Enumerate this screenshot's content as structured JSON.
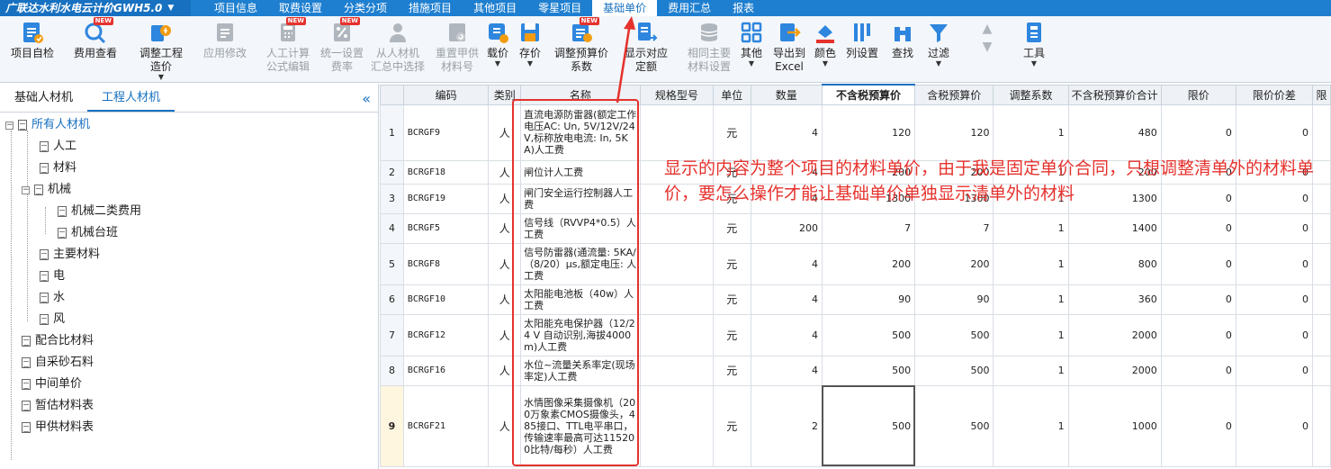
{
  "app": {
    "title": "广联达水利水电云计价GWH5.0"
  },
  "menu": [
    {
      "label": "项目信息"
    },
    {
      "label": "取费设置"
    },
    {
      "label": "分类分项"
    },
    {
      "label": "措施项目"
    },
    {
      "label": "其他项目"
    },
    {
      "label": "零星项目"
    },
    {
      "label": "基础单价",
      "active": true
    },
    {
      "label": "费用汇总"
    },
    {
      "label": "报表"
    }
  ],
  "toolbar": {
    "self_check": "项目自检",
    "fee_view": "费用查看",
    "adjust_price_1": "调整工程",
    "adjust_price_2": "造价",
    "apply_modify": "应用修改",
    "labor_calc_1": "人工计算",
    "labor_calc_2": "公式编辑",
    "unify_rate_1": "统一设置",
    "unify_rate_2": "费率",
    "select_1": "从人材机",
    "select_2": "汇总中选择",
    "reset_1": "重置甲供",
    "reset_2": "材料号",
    "load_price": "载价",
    "save_price": "存价",
    "adjust_budget_1": "调整预算价",
    "adjust_budget_2": "系数",
    "show_quota_1": "显示对应",
    "show_quota_2": "定额",
    "same_main_1": "相同主要",
    "same_main_2": "材料设置",
    "other": "其他",
    "export_1": "导出到",
    "export_2": "Excel",
    "color": "颜色",
    "col_setting": "列设置",
    "find": "查找",
    "filter": "过滤",
    "tools": "工具",
    "new_badge": "NEW"
  },
  "leftpanel": {
    "tabs": [
      {
        "label": "基础人材机"
      },
      {
        "label": "工程人材机",
        "active": true
      }
    ],
    "tree": [
      {
        "label": "所有人材机"
      },
      {
        "label": "人工"
      },
      {
        "label": "材料"
      },
      {
        "label": "机械"
      },
      {
        "label": "机械二类费用"
      },
      {
        "label": "机械台班"
      },
      {
        "label": "主要材料"
      },
      {
        "label": "电"
      },
      {
        "label": "水"
      },
      {
        "label": "风"
      },
      {
        "label": "配合比材料"
      },
      {
        "label": "自采砂石料"
      },
      {
        "label": "中间单价"
      },
      {
        "label": "暂估材料表"
      },
      {
        "label": "甲供材料表"
      }
    ]
  },
  "grid": {
    "headers": [
      "",
      "编码",
      "类别",
      "名称",
      "规格型号",
      "单位",
      "数量",
      "不含税预算价",
      "含税预算价",
      "调整系数",
      "不含税预算价合计",
      "限价",
      "限价价差",
      "限"
    ],
    "rows": [
      {
        "n": "1",
        "code": "BCRGF9",
        "cat": "人",
        "name": "直流电源防雷器(额定工作电压AC: Un, 5V/12V/24V,标称放电电流: In, 5KA)人工费",
        "unit": "元",
        "qty": "4",
        "price": "120",
        "taxprice": "120",
        "coef": "1",
        "total": "480",
        "limit": "0",
        "diff": "0"
      },
      {
        "n": "2",
        "code": "BCRGF18",
        "cat": "人",
        "name": "闸位计人工费",
        "unit": "元",
        "qty": "4",
        "price": "200",
        "taxprice": "200",
        "coef": "1",
        "total": "200",
        "limit": "0",
        "diff": "0"
      },
      {
        "n": "3",
        "code": "BCRGF19",
        "cat": "人",
        "name": "闸门安全运行控制器人工费",
        "unit": "元",
        "qty": "4",
        "price": "1300",
        "taxprice": "1300",
        "coef": "1",
        "total": "1300",
        "limit": "0",
        "diff": "0"
      },
      {
        "n": "4",
        "code": "BCRGF5",
        "cat": "人",
        "name": "信号线（RVVP4*0.5）人工费",
        "unit": "元",
        "qty": "200",
        "price": "7",
        "taxprice": "7",
        "coef": "1",
        "total": "1400",
        "limit": "0",
        "diff": "0"
      },
      {
        "n": "5",
        "code": "BCRGF8",
        "cat": "人",
        "name": "信号防雷器(通流量: 5KA/（8/20）μs,额定电压: 人工费",
        "unit": "元",
        "qty": "4",
        "price": "200",
        "taxprice": "200",
        "coef": "1",
        "total": "800",
        "limit": "0",
        "diff": "0"
      },
      {
        "n": "6",
        "code": "BCRGF10",
        "cat": "人",
        "name": "太阳能电池板（40w）人工费",
        "unit": "元",
        "qty": "4",
        "price": "90",
        "taxprice": "90",
        "coef": "1",
        "total": "360",
        "limit": "0",
        "diff": "0"
      },
      {
        "n": "7",
        "code": "BCRGF12",
        "cat": "人",
        "name": "太阳能充电保护器（12/24 V 自动识别,海拔4000 m)人工费",
        "unit": "元",
        "qty": "4",
        "price": "500",
        "taxprice": "500",
        "coef": "1",
        "total": "2000",
        "limit": "0",
        "diff": "0"
      },
      {
        "n": "8",
        "code": "BCRGF16",
        "cat": "人",
        "name": "水位~流量关系率定(现场率定)人工费",
        "unit": "元",
        "qty": "4",
        "price": "500",
        "taxprice": "500",
        "coef": "1",
        "total": "2000",
        "limit": "0",
        "diff": "0"
      },
      {
        "n": "9",
        "code": "BCRGF21",
        "cat": "人",
        "name": "水情图像采集摄像机（200万象素CMOS摄像头，485接口、TTL电平串口，传输速率最高可达115200比特/每秒）人工费",
        "unit": "元",
        "qty": "2",
        "price": "500",
        "taxprice": "500",
        "coef": "1",
        "total": "1000",
        "limit": "0",
        "diff": "0"
      }
    ]
  },
  "annotation": {
    "text": "显示的内容为整个项目的材料单价，由于我是固定单价合同，只想调整清单外的材料单价，要怎么操作才能让基础单价单独显示清单外的材料"
  },
  "colors": {
    "accent": "#1770c0",
    "annotation": "#e5322d"
  }
}
